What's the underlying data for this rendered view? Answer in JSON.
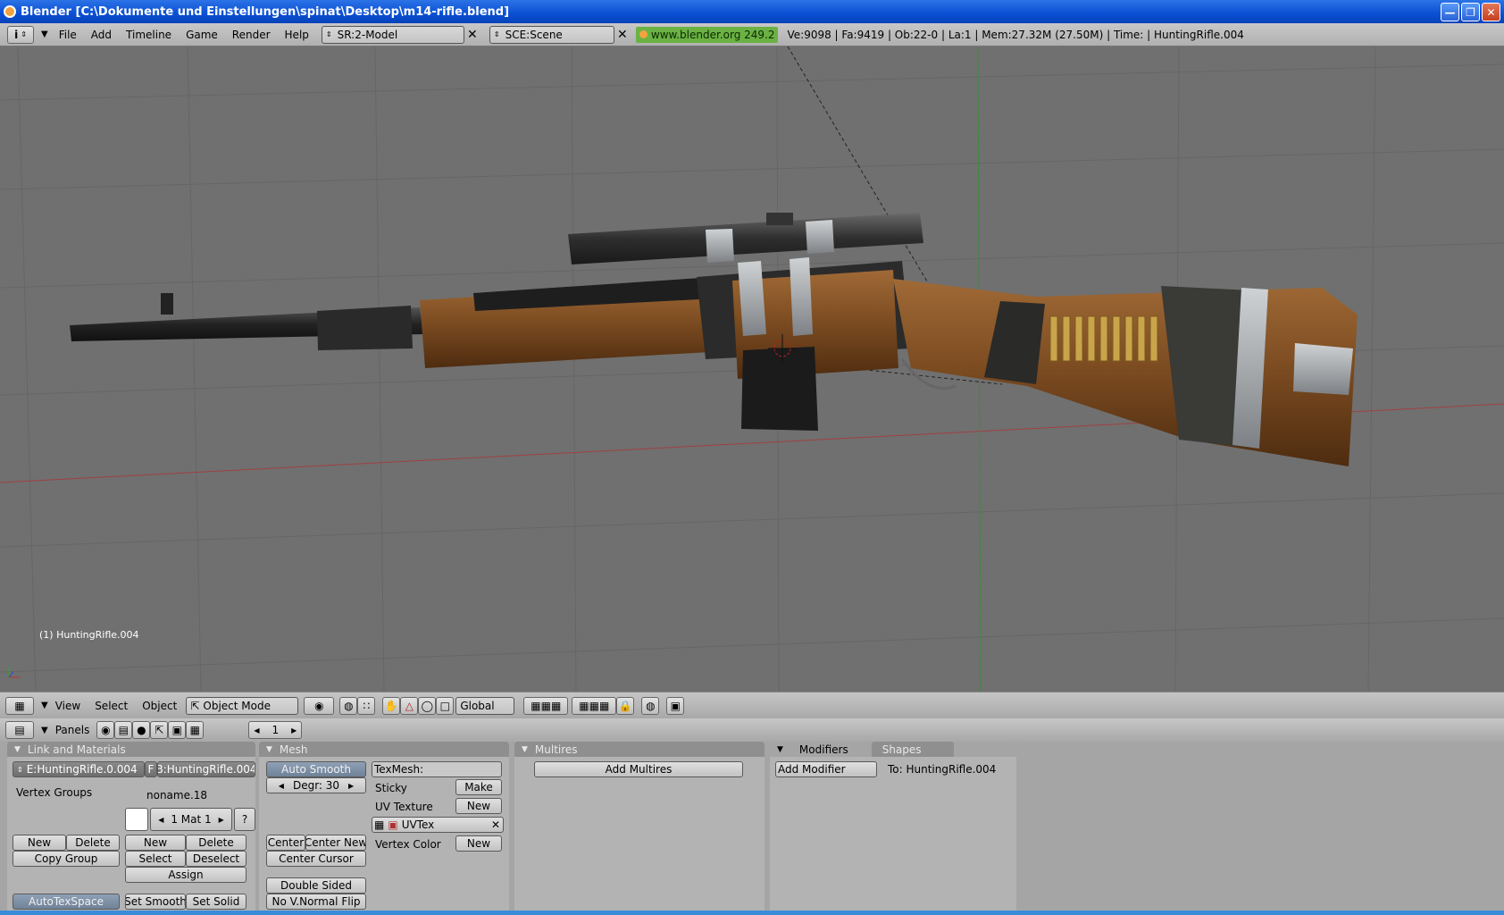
{
  "window": {
    "title": "Blender [C:\\Dokumente und Einstellungen\\spinat\\Desktop\\m14-rifle.blend]"
  },
  "infobar": {
    "menus": [
      "File",
      "Add",
      "Timeline",
      "Game",
      "Render",
      "Help"
    ],
    "screen": "SR:2-Model",
    "scene": "SCE:Scene",
    "link": "www.blender.org 249.2",
    "stats": "Ve:9098 | Fa:9419 | Ob:22-0 | La:1  | Mem:27.32M (27.50M)  | Time: | HuntingRifle.004"
  },
  "viewport": {
    "object_label": "(1) HuntingRifle.004"
  },
  "header3d": {
    "menus": [
      "View",
      "Select",
      "Object"
    ],
    "mode": "Object Mode",
    "orientation": "Global"
  },
  "buttons": {
    "panels_label": "Panels",
    "frame": "1",
    "link_materials": {
      "title": "Link and Materials",
      "mesh_name": "E:HuntingRifle.0.004",
      "f_flag": "F",
      "object_name": "B:HuntingRifle.004",
      "vertex_groups": "Vertex Groups",
      "group_name": "noname.18",
      "material": "1 Mat 1",
      "help": "?",
      "new": "New",
      "delete": "Delete",
      "copy_group": "Copy Group",
      "mat_new": "New",
      "mat_delete": "Delete",
      "select": "Select",
      "deselect": "Deselect",
      "assign": "Assign",
      "autotexspace": "AutoTexSpace",
      "set_smooth": "Set Smooth",
      "set_solid": "Set Solid"
    },
    "mesh": {
      "title": "Mesh",
      "auto_smooth": "Auto Smooth",
      "degr": "Degr: 30",
      "texmesh": "TexMesh:",
      "sticky": "Sticky",
      "make": "Make",
      "uv_texture": "UV Texture",
      "uv_new": "New",
      "uvtex": "UVTex",
      "vertex_color": "Vertex Color",
      "vc_new": "New",
      "center": "Center",
      "center_new": "Center New",
      "center_cursor": "Center Cursor",
      "double_sided": "Double Sided",
      "no_vnormal_flip": "No V.Normal Flip"
    },
    "multires": {
      "title": "Multires",
      "add_multires": "Add Multires"
    },
    "modifiers": {
      "title": "Modifiers",
      "shapes_tab": "Shapes",
      "add_modifier": "Add Modifier",
      "to": "To: HuntingRifle.004"
    }
  },
  "colors": {
    "viewport_bg": "#707070",
    "grid": "#626262",
    "xaxis": "#a04040",
    "yaxis": "#3e8a3e",
    "wood": "#7a4a20",
    "metal": "#2a2a2a",
    "steel": "#9aa0a4"
  }
}
